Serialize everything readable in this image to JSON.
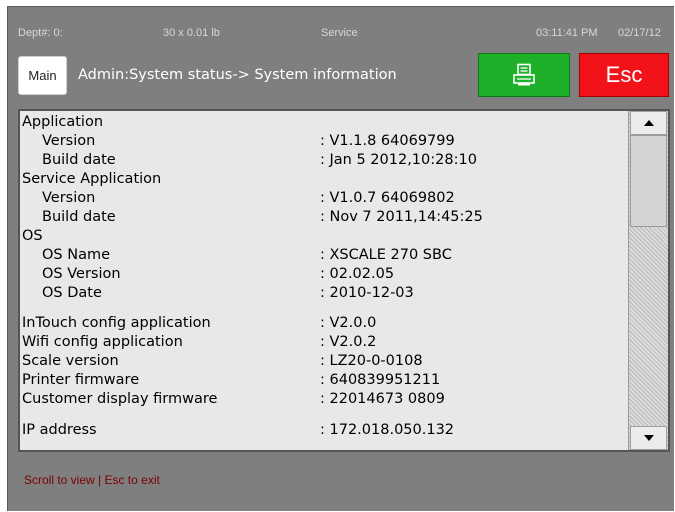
{
  "statusbar": {
    "dept": "Dept#: 0:",
    "weight": "30 x 0.01 lb",
    "mode": "Service",
    "time": "03:11:41 PM",
    "date": "02/17/12"
  },
  "header": {
    "main_label": "Main",
    "title": "Admin:System status-> System information",
    "print_icon": "printer-icon",
    "esc_label": "Esc"
  },
  "colors": {
    "print_button": "#1fb02a",
    "esc_button": "#f2121a",
    "frame": "#7f7f7f",
    "panel": "#e8e8e8",
    "footer_text": "#7a0000"
  },
  "info": {
    "rows": [
      {
        "label": "Application",
        "value": ""
      },
      {
        "label": "Version",
        "value": ": V1.1.8 64069799"
      },
      {
        "label": "Build date",
        "value": ": Jan  5 2012,10:28:10"
      },
      {
        "label": "Service Application",
        "value": ""
      },
      {
        "label": "Version",
        "value": ": V1.0.7 64069802"
      },
      {
        "label": "Build date",
        "value": ": Nov  7 2011,14:45:25"
      },
      {
        "label": "OS",
        "value": ""
      },
      {
        "label": "OS Name",
        "value": ": XSCALE 270 SBC"
      },
      {
        "label": "OS Version",
        "value": ": 02.02.05"
      },
      {
        "label": "OS Date",
        "value": ": 2010-12-03"
      },
      {
        "label": "InTouch config application",
        "value": ": V2.0.0"
      },
      {
        "label": "Wifi config application",
        "value": ": V2.0.2"
      },
      {
        "label": "Scale version",
        "value": ": LZ20-0-0108"
      },
      {
        "label": "Printer firmware",
        "value": ": 640839951211"
      },
      {
        "label": "Customer display firmware",
        "value": ": 22014673   0809"
      },
      {
        "label": "IP address",
        "value": ": 172.018.050.132"
      }
    ]
  },
  "footer": {
    "hint": "Scroll to view | Esc to exit"
  }
}
